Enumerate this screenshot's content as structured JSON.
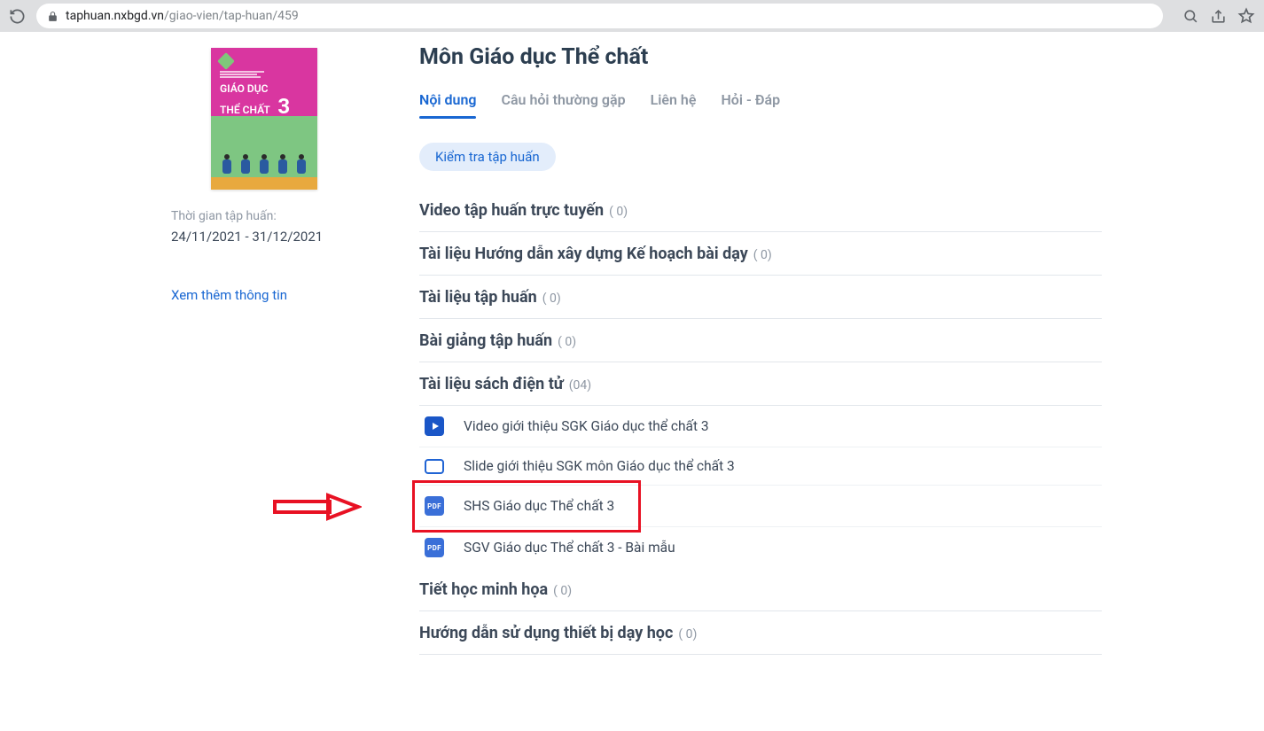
{
  "browser": {
    "url_domain": "taphuan.nxbgd.vn",
    "url_path": "/giao-vien/tap-huan/459"
  },
  "sidebar": {
    "cover_line1": "GIÁO DỤC",
    "cover_line2": "THỂ CHẤT",
    "cover_grade": "3",
    "meta_label": "Thời gian tập huấn:",
    "meta_value": "24/11/2021 - 31/12/2021",
    "info_link": "Xem thêm thông tin"
  },
  "main": {
    "title": "Môn Giáo dục Thể chất",
    "tabs": [
      {
        "label": "Nội dung",
        "active": true
      },
      {
        "label": "Câu hỏi thường gặp",
        "active": false
      },
      {
        "label": "Liên hệ",
        "active": false
      },
      {
        "label": "Hỏi - Đáp",
        "active": false
      }
    ],
    "check_label": "Kiểm tra tập huấn",
    "sections": [
      {
        "title": "Video tập huấn trực tuyến",
        "count": "( 0)"
      },
      {
        "title": "Tài liệu Hướng dẫn xây dựng Kế hoạch bài dạy",
        "count": "( 0)"
      },
      {
        "title": "Tài liệu tập huấn",
        "count": "( 0)"
      },
      {
        "title": "Bài giảng tập huấn",
        "count": "( 0)"
      },
      {
        "title": "Tài liệu sách điện tử",
        "count": "(04)"
      },
      {
        "title": "Tiết học minh họa",
        "count": "( 0)"
      },
      {
        "title": "Hướng dẫn sử dụng thiết bị dạy học",
        "count": "( 0)"
      }
    ],
    "ebook_items": [
      {
        "icon": "play",
        "label": "Video giới thiệu SGK Giáo dục thể chất 3"
      },
      {
        "icon": "slide",
        "label": "Slide giới thiệu SGK môn Giáo dục thể chất 3"
      },
      {
        "icon": "pdf",
        "label": "SHS Giáo dục Thể chất 3",
        "highlight": true
      },
      {
        "icon": "pdf",
        "label": "SGV Giáo dục Thể chất 3 - Bài mẫu"
      }
    ]
  }
}
